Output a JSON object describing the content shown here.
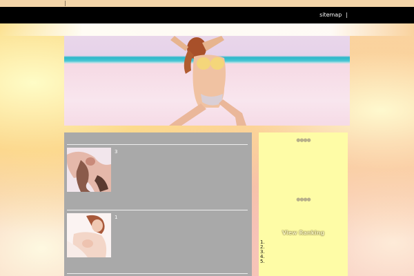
{
  "topbar": {
    "separator": "|"
  },
  "nav": {
    "sitemap_label": "sitemap",
    "separator": "|"
  },
  "posts": [
    {
      "number": "3"
    },
    {
      "number": "1"
    }
  ],
  "sidebar": {
    "header1_dots": "●●●●",
    "header2_dots": "●●●●",
    "ranking_title": "View Ranking",
    "ranking_items": [
      "1.",
      "2.",
      "3.",
      "4.",
      "5."
    ]
  }
}
